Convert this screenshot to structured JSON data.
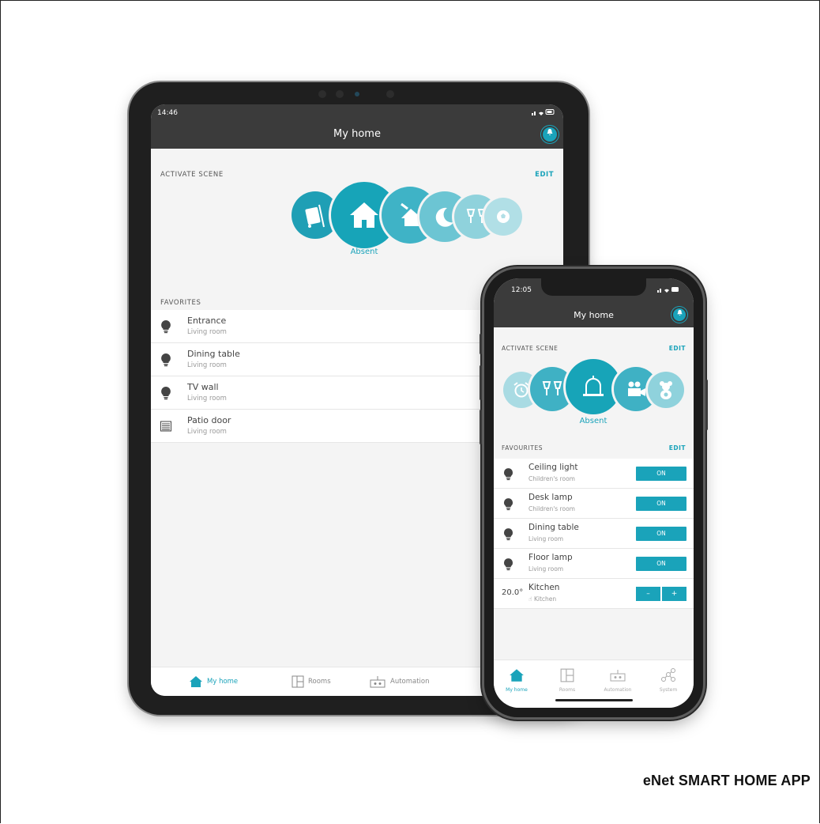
{
  "tablet": {
    "status": {
      "time": "14:46"
    },
    "header": {
      "title": "My home"
    },
    "scene_section": {
      "title": "ACTIVATE SCENE",
      "edit_label": "EDIT",
      "selected_label": "Absent"
    },
    "scene_icons": [
      "suitcase-icon",
      "home-icon",
      "home-leave-icon",
      "moon-icon",
      "glasses-icon",
      "football-icon"
    ],
    "favorites": {
      "title": "FAVORITES",
      "items": [
        {
          "name": "Entrance",
          "room": "Living room",
          "icon": "bulb-icon"
        },
        {
          "name": "Dining table",
          "room": "Living room",
          "icon": "bulb-icon"
        },
        {
          "name": "TV wall",
          "room": "Living room",
          "icon": "bulb-icon"
        },
        {
          "name": "Patio door",
          "room": "Living room",
          "icon": "shutter-icon"
        }
      ]
    },
    "nav": {
      "items": [
        {
          "label": "My home",
          "active": true
        },
        {
          "label": "Rooms"
        },
        {
          "label": "Automation"
        }
      ]
    }
  },
  "phone": {
    "status": {
      "time": "12:05"
    },
    "header": {
      "title": "My home"
    },
    "scene_section": {
      "title": "ACTIVATE SCENE",
      "edit_label": "EDIT",
      "selected_label": "Absent"
    },
    "scene_icons": [
      "alarm-clock-icon",
      "glasses-icon",
      "bell-icon",
      "camera-icon",
      "teddy-icon"
    ],
    "favourites": {
      "title": "FAVOURITES",
      "edit_label": "EDIT",
      "items": [
        {
          "name": "Ceiling light",
          "room": "Children's room",
          "action": "ON"
        },
        {
          "name": "Desk lamp",
          "room": "Children's room",
          "action": "ON"
        },
        {
          "name": "Dining table",
          "room": "Living room",
          "action": "ON"
        },
        {
          "name": "Floor lamp",
          "room": "Living room",
          "action": "ON"
        }
      ],
      "thermostat": {
        "temp": "20.0°",
        "name": "Kitchen",
        "room": "Kitchen",
        "minus": "–",
        "plus": "+"
      }
    },
    "nav": {
      "items": [
        {
          "label": "My home",
          "active": true
        },
        {
          "label": "Rooms"
        },
        {
          "label": "Automation"
        },
        {
          "label": "System"
        }
      ]
    }
  },
  "caption": "eNet SMART HOME APP",
  "colors": {
    "accent": "#1aa3ba",
    "header": "#3b3b3b",
    "background": "#f4f4f4"
  }
}
